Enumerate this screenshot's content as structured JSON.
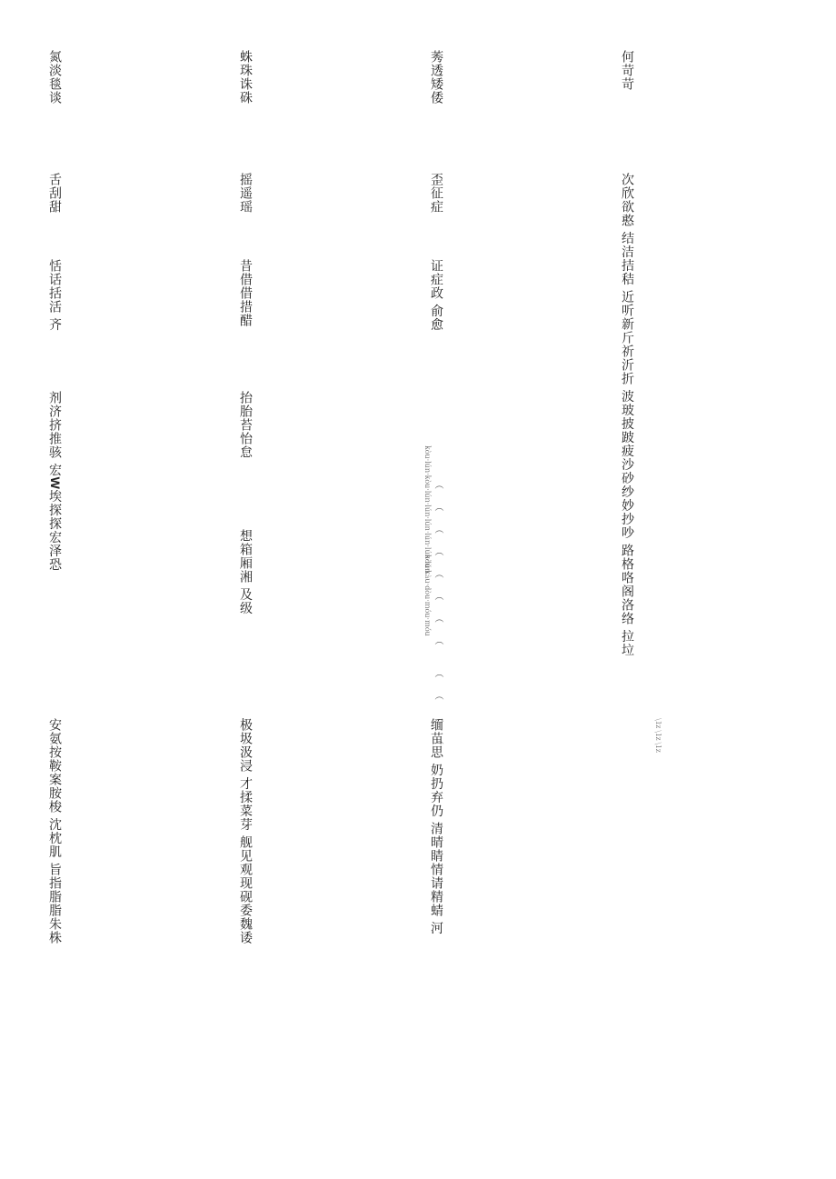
{
  "header_right": "\\1z \\1z \\1z",
  "col1_line1": "次欣欲憨 结洁拮秸 近听新斤祈沂折 波玻披跛疲沙砂纱妙抄吵 路格咯阁洛络 拉垃",
  "col1_heading": "何苛苛",
  "col2_heading": "莠透矮倭",
  "col2_a": "歪征症",
  "col2_b": "证症政 俞愈",
  "col2_ruby1": "kòu·lún·kòu·lún·lún·lún·lún·lún·lǔn",
  "col2_parens": "（ （ （ （ （ （ （ （ 　（ （ （ （",
  "col2_ruby2": "kòu·kàu·dòu·móu·móu",
  "col2_line2": "缅苗思 奶扔弃仍 清晴睛情请精蜻 河",
  "col3_heading": "蛛珠诛硃",
  "col3_a": "摇遥瑶",
  "col3_b": "昔借借措醋",
  "col3_c": "抬胎苔怡怠",
  "col3_d": "想箱厢湘 及级",
  "col3_line2": "极圾汲浸 才揉菜芽 舰见观现砚委魏诿",
  "col4_heading": "氮淡毯谈",
  "col4_a": "舌刮甜",
  "col4_b": "恬话括活 齐",
  "col4_c_pre": "剂济挤推骇 宏",
  "col4_c_w": "W",
  "col4_c_post": "埃探探宏泽恐",
  "col4_line2": "安氨按鞍案胺梭 沈枕肌 旨指脂脂朱株"
}
